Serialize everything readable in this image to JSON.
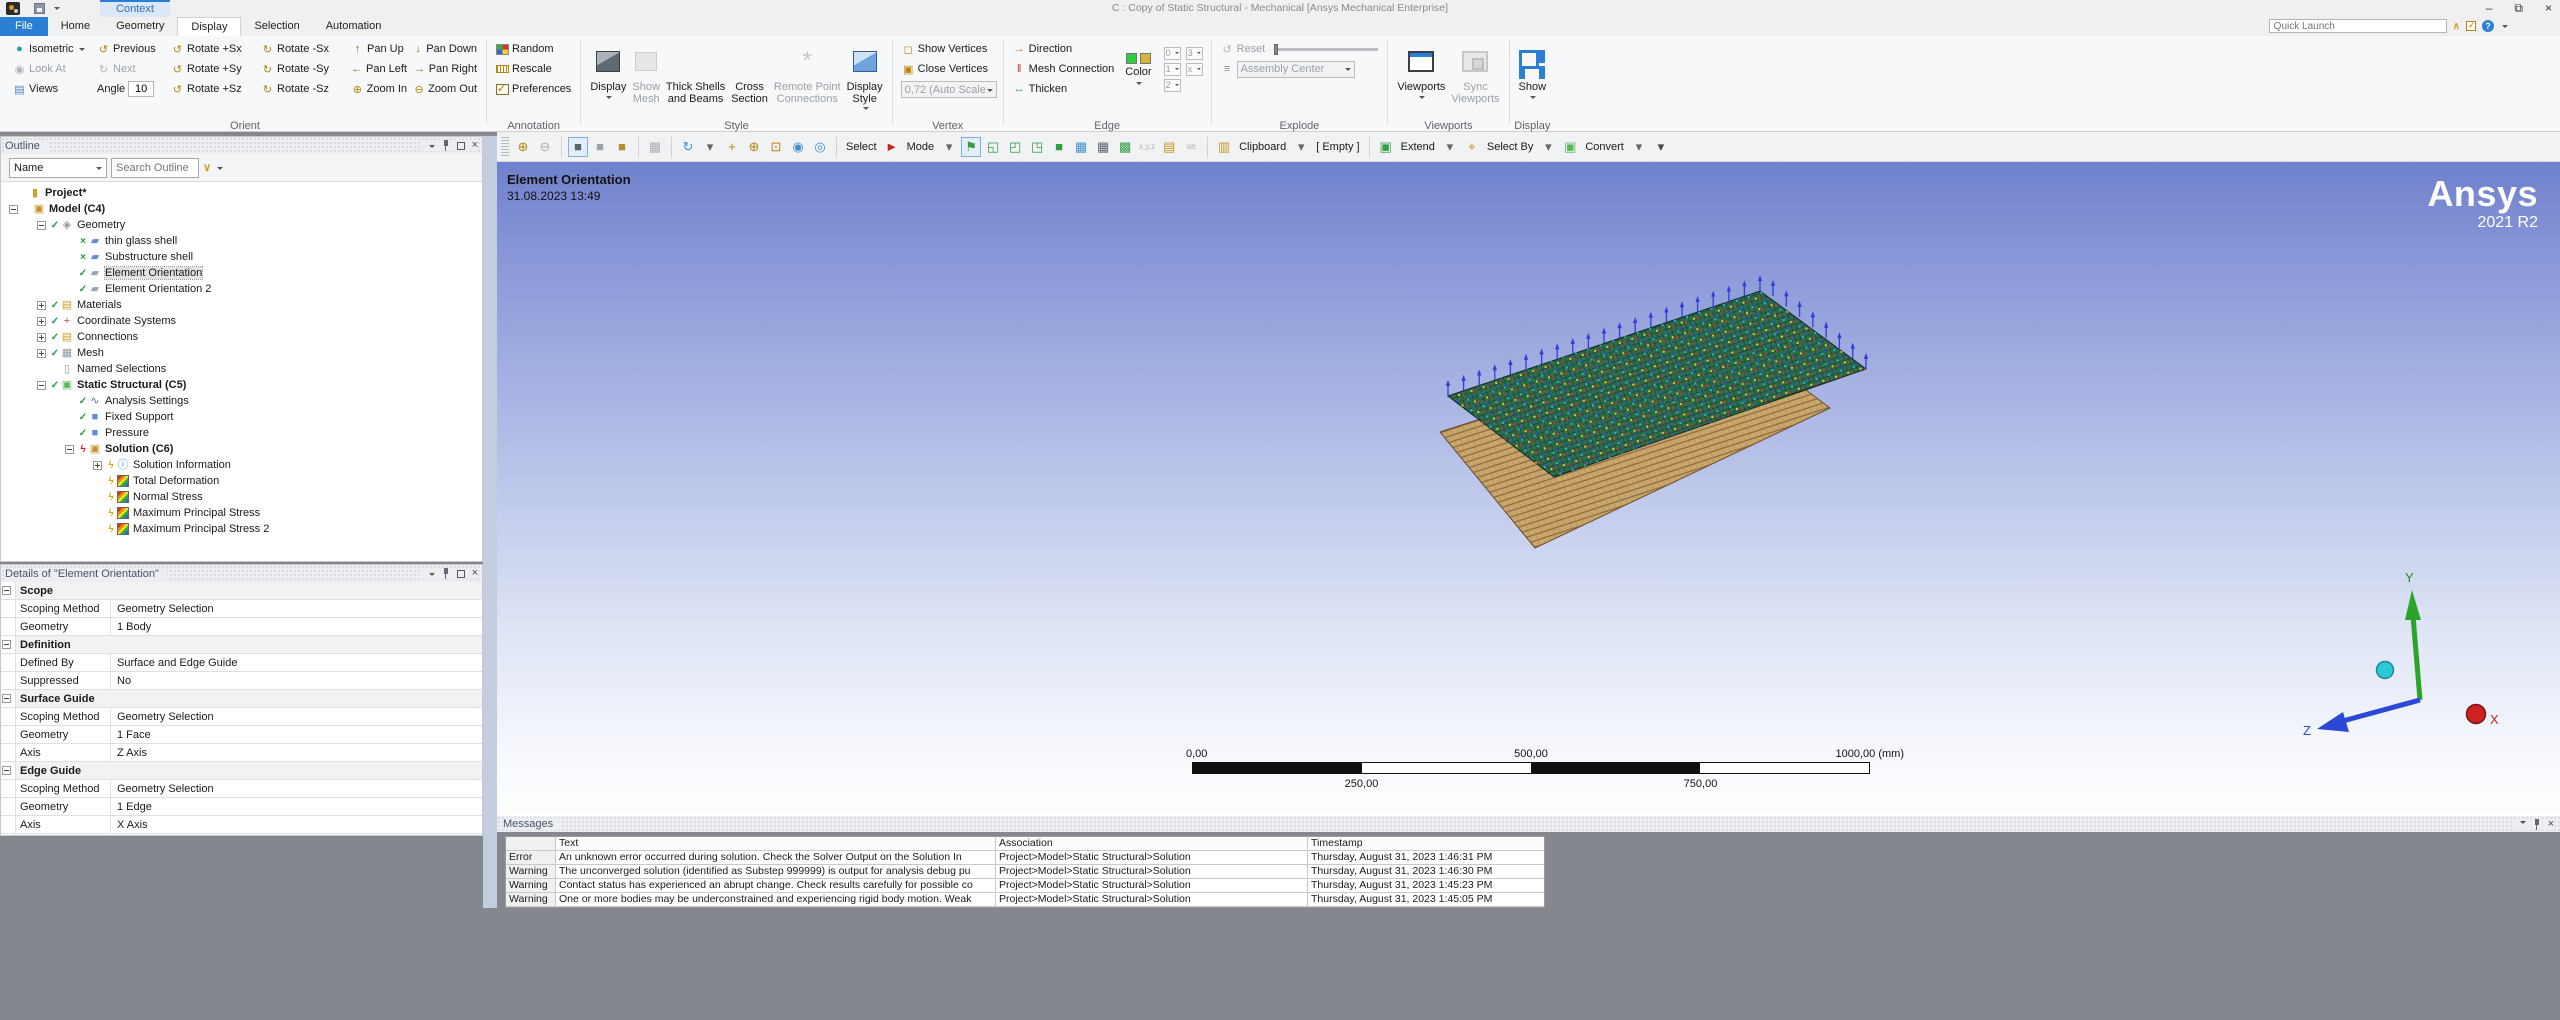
{
  "window": {
    "title": "C : Copy of Static Structural - Mechanical [Ansys Mechanical Enterprise]",
    "context_label": "Context",
    "controls": {
      "minimize": "–",
      "restore": "⧉",
      "close": "×"
    }
  },
  "quick_launch": {
    "placeholder": "Quick Launch"
  },
  "tabs": [
    {
      "label": "File",
      "style": "file"
    },
    {
      "label": "Home"
    },
    {
      "label": "Geometry"
    },
    {
      "label": "Display",
      "active": true
    },
    {
      "label": "Selection"
    },
    {
      "label": "Automation"
    }
  ],
  "ribbon": {
    "groups": [
      {
        "key": "orient",
        "label": "Orient",
        "type": "grid",
        "cells": [
          {
            "icon": "isometric-icon",
            "glyph": "●",
            "color": "#18a3a8",
            "label": "Isometric",
            "caret": true
          },
          {
            "icon": "previous-icon",
            "glyph": "↺",
            "color": "#b8860b",
            "label": "Previous"
          },
          {
            "icon": "rotate-plus-icon",
            "glyph": "↺",
            "color": "#b8860b",
            "label": "Rotate +Sx"
          },
          {
            "icon": "rotate-minus-icon",
            "glyph": "↻",
            "color": "#b8860b",
            "label": "Rotate -Sx"
          },
          {
            "icon": "pan-up-icon",
            "glyph": "↑",
            "color": "#8a6d1f",
            "label": "Pan Up"
          },
          {
            "icon": "pan-down-icon",
            "glyph": "↓",
            "color": "#8a6d1f",
            "label": "Pan Down"
          },
          {
            "icon": "look-at-icon",
            "glyph": "◉",
            "color": "#9aa0a6",
            "label": "Look At",
            "disabled": true
          },
          {
            "icon": "next-icon",
            "glyph": "↻",
            "color": "#9aa0a6",
            "label": "Next",
            "disabled": true
          },
          {
            "icon": "rotate-plus-icon",
            "glyph": "↺",
            "color": "#b8860b",
            "label": "Rotate +Sy"
          },
          {
            "icon": "rotate-minus-icon",
            "glyph": "↻",
            "color": "#b8860b",
            "label": "Rotate -Sy"
          },
          {
            "icon": "pan-left-icon",
            "glyph": "←",
            "color": "#8a6d1f",
            "label": "Pan Left"
          },
          {
            "icon": "pan-right-icon",
            "glyph": "→",
            "color": "#8a6d1f",
            "label": "Pan Right"
          },
          {
            "icon": "views-icon",
            "glyph": "▤",
            "color": "#4a7fc1",
            "label": "Views"
          },
          {
            "angle_label": "Angle",
            "angle_value": "10"
          },
          {
            "icon": "rotate-plus-icon",
            "glyph": "↺",
            "color": "#b8860b",
            "label": "Rotate +Sz"
          },
          {
            "icon": "rotate-minus-icon",
            "glyph": "↻",
            "color": "#b8860b",
            "label": "Rotate -Sz"
          },
          {
            "icon": "zoom-in-icon",
            "glyph": "⊕",
            "color": "#b8860b",
            "label": "Zoom In"
          },
          {
            "icon": "zoom-out-icon",
            "glyph": "⊖",
            "color": "#b8860b",
            "label": "Zoom Out"
          }
        ]
      },
      {
        "key": "annotation",
        "label": "Annotation",
        "type": "stack",
        "buttons": [
          {
            "icon": "random-colors",
            "label": "Random"
          },
          {
            "icon": "rescale",
            "label": "Rescale"
          },
          {
            "icon": "preferences",
            "label": "Preferences"
          }
        ]
      },
      {
        "key": "style",
        "label": "Style",
        "type": "big",
        "buttons": [
          {
            "icon": "cube-dark",
            "label": "Display",
            "caret": true
          },
          {
            "icon": "cube-gray",
            "label": "Show\nMesh",
            "disabled": true
          },
          {
            "icon": "ibeam-dark",
            "label": "Thick Shells\nand Beams"
          },
          {
            "icon": "ibeam-gold",
            "label": "Cross\nSection"
          },
          {
            "icon": "starburst",
            "glyph": "*",
            "label": "Remote Point\nConnections",
            "disabled": true
          },
          {
            "icon": "cube-blue",
            "label": "Display\nStyle",
            "caret": true
          }
        ]
      },
      {
        "key": "vertex",
        "label": "Vertex",
        "type": "stack",
        "buttons": [
          {
            "icon": "show-vertices-icon",
            "glyph": "◻",
            "color": "#b8860b",
            "label": "Show Vertices"
          },
          {
            "icon": "close-vertices-icon",
            "glyph": "▣",
            "color": "#b8860b",
            "label": "Close Vertices"
          },
          {
            "combo": "0,72 (Auto Scale",
            "disabled": true
          }
        ]
      },
      {
        "key": "edge",
        "label": "Edge",
        "type": "edge",
        "buttons": [
          {
            "icon": "direction-icon",
            "glyph": "→",
            "color": "#d07818",
            "label": "Direction"
          },
          {
            "icon": "mesh-connection-icon",
            "glyph": "‖",
            "color": "#c23030",
            "label": "Mesh Connection"
          },
          {
            "icon": "thicken-icon",
            "glyph": "↔",
            "color": "#2f9e44",
            "label": "Thicken"
          }
        ],
        "color_label": "Color",
        "swatches": [
          "#2ecc40",
          "#d9b43a"
        ],
        "minis": [
          "0",
          "3",
          "1",
          "x",
          "2"
        ]
      },
      {
        "key": "explode",
        "label": "Explode",
        "type": "explode",
        "reset_label": "Reset",
        "combo": "Assembly Center"
      },
      {
        "key": "viewports",
        "label": "Viewports",
        "type": "big",
        "buttons": [
          {
            "icon": "viewport-window",
            "label": "Viewports",
            "caret": true
          },
          {
            "icon": "viewport-lock",
            "label": "Sync\nViewports",
            "disabled": true
          }
        ]
      },
      {
        "key": "display",
        "label": "Display",
        "type": "big",
        "buttons": [
          {
            "icon": "show-layout",
            "label": "Show",
            "caret": true
          }
        ]
      }
    ]
  },
  "gtoolbar": {
    "items": [
      {
        "n": "toolbar-grip",
        "t": "grip"
      },
      {
        "n": "zoom-in-icon",
        "g": "⊕",
        "c": "#b8860b"
      },
      {
        "n": "zoom-out-icon",
        "g": "⊖",
        "c": "#a9adb2"
      },
      {
        "t": "sep"
      },
      {
        "n": "shaded-exterior-edges-icon",
        "g": "■",
        "c": "#5a6572",
        "boxed": true
      },
      {
        "n": "shaded-exterior-icon",
        "g": "■",
        "c": "#9aa3ad"
      },
      {
        "n": "wireframe-icon",
        "g": "■",
        "c": "#b98c2f"
      },
      {
        "t": "sep"
      },
      {
        "n": "multi-viewport-icon",
        "g": "▦",
        "c": "#a9adb2"
      },
      {
        "t": "sep"
      },
      {
        "n": "rotate-mode-icon",
        "g": "↻",
        "c": "#3f8fd2"
      },
      {
        "n": "rotate-mode-caret",
        "g": "▾",
        "c": "#666"
      },
      {
        "n": "pan-mode-icon",
        "g": "+",
        "c": "#b8860b"
      },
      {
        "n": "zoom-mode-icon",
        "g": "⊕",
        "c": "#b8860b"
      },
      {
        "n": "box-zoom-icon",
        "g": "⊡",
        "c": "#b8860b"
      },
      {
        "n": "zoom-fit-icon",
        "g": "◉",
        "c": "#3f8fd2"
      },
      {
        "n": "zoom-all-icon",
        "g": "◎",
        "c": "#3f8fd2"
      },
      {
        "t": "sep"
      },
      {
        "t": "text",
        "n": "select-label",
        "label": "Select"
      },
      {
        "n": "select-cursor-icon",
        "g": "►",
        "c": "#cc2222"
      },
      {
        "t": "text",
        "n": "mode-label",
        "label": "Mode"
      },
      {
        "n": "mode-caret",
        "g": "▾",
        "c": "#666"
      },
      {
        "n": "select-vertex-icon",
        "g": "⚑",
        "c": "#2f9e44",
        "boxed": true
      },
      {
        "n": "select-edge-icon",
        "g": "◱",
        "c": "#2f9e44"
      },
      {
        "n": "select-face-icon",
        "g": "◰",
        "c": "#2f9e44"
      },
      {
        "n": "select-body-icon",
        "g": "◳",
        "c": "#2f9e44"
      },
      {
        "n": "select-body-solid-icon",
        "g": "■",
        "c": "#2f9e44"
      },
      {
        "n": "select-mesh-icon",
        "g": "▦",
        "c": "#3f8fd2"
      },
      {
        "n": "mesh-element-select-icon",
        "g": "▦",
        "c": "#5a6572"
      },
      {
        "n": "mesh-node-select-icon",
        "g": "▩",
        "c": "#2f9e44"
      },
      {
        "n": "coordinates-icon",
        "g": "x,y,z",
        "c": "#b0b4b9",
        "small": true
      },
      {
        "n": "tag-icon",
        "g": "▤",
        "c": "#c9971c"
      },
      {
        "n": "annotation-label-icon",
        "g": "ab",
        "c": "#b0b4b9",
        "small": true
      },
      {
        "t": "sep"
      },
      {
        "n": "clipboard-icon",
        "g": "▥",
        "c": "#c9971c"
      },
      {
        "t": "text",
        "n": "clipboard-label",
        "label": "Clipboard"
      },
      {
        "n": "clipboard-caret",
        "g": "▾",
        "c": "#666"
      },
      {
        "t": "text",
        "n": "clipboard-empty-label",
        "label": "[ Empty ]"
      },
      {
        "t": "sep"
      },
      {
        "n": "extend-icon",
        "g": "▣",
        "c": "#2f9e44"
      },
      {
        "t": "text",
        "n": "extend-label",
        "label": "Extend"
      },
      {
        "n": "extend-caret",
        "g": "▾",
        "c": "#666"
      },
      {
        "n": "select-by-icon",
        "g": "⌖",
        "c": "#c9971c"
      },
      {
        "t": "text",
        "n": "select-by-label",
        "label": "Select By"
      },
      {
        "n": "select-by-caret",
        "g": "▾",
        "c": "#666"
      },
      {
        "n": "convert-icon",
        "g": "▣",
        "c": "#57b857"
      },
      {
        "t": "text",
        "n": "convert-label",
        "label": "Convert"
      },
      {
        "n": "convert-caret",
        "g": "▾",
        "c": "#666"
      },
      {
        "n": "toolbar-overflow-caret",
        "g": "▾",
        "c": "#444"
      }
    ]
  },
  "outline": {
    "title": "Outline",
    "filter_label": "Name",
    "search_placeholder": "Search Outline",
    "markers": {
      "check": "✓",
      "xgreen": "×",
      "boltred": "ϟ",
      "boltyellow": "ϟ"
    },
    "tree": [
      {
        "label": "Project*",
        "lvl": 0,
        "icon": "project",
        "glyph": "▮",
        "color": "#c9a227",
        "bold": true
      },
      {
        "label": "Model (C4)",
        "lvl": 1,
        "icon": "model",
        "glyph": "▣",
        "color": "#c98f2c",
        "exp": "minus",
        "bold": true
      },
      {
        "label": "Geometry",
        "lvl": 2,
        "icon": "geometry",
        "glyph": "◈",
        "color": "#8a98a8",
        "exp": "minus",
        "marker": "check"
      },
      {
        "label": "thin glass shell",
        "lvl": 3,
        "icon": "surface-body",
        "glyph": "▰",
        "color": "#5b8dd9",
        "marker": "xgreen"
      },
      {
        "label": "Substructure shell",
        "lvl": 3,
        "icon": "surface-body",
        "glyph": "▰",
        "color": "#5b8dd9",
        "marker": "xgreen"
      },
      {
        "label": "Element Orientation",
        "lvl": 3,
        "icon": "element-orientation",
        "glyph": "▰",
        "color": "#9aa4b0",
        "marker": "check",
        "selected": true
      },
      {
        "label": "Element Orientation 2",
        "lvl": 3,
        "icon": "element-orientation",
        "glyph": "▰",
        "color": "#9aa4b0",
        "marker": "check"
      },
      {
        "label": "Materials",
        "lvl": 2,
        "icon": "materials",
        "glyph": "▤",
        "color": "#c9a227",
        "exp": "plus",
        "marker": "check"
      },
      {
        "label": "Coordinate Systems",
        "lvl": 2,
        "icon": "coordinate-systems",
        "glyph": "+",
        "color": "#cc4444",
        "exp": "plus",
        "marker": "check"
      },
      {
        "label": "Connections",
        "lvl": 2,
        "icon": "connections",
        "glyph": "▤",
        "color": "#c9a227",
        "exp": "plus",
        "marker": "check"
      },
      {
        "label": "Mesh",
        "lvl": 2,
        "icon": "mesh",
        "glyph": "▦",
        "color": "#8a98a8",
        "exp": "plus",
        "marker": "check"
      },
      {
        "label": "Named Selections",
        "lvl": 2,
        "icon": "named-selections",
        "glyph": "▯",
        "color": "#8a98a8"
      },
      {
        "label": "Static Structural (C5)",
        "lvl": 2,
        "icon": "static-structural",
        "glyph": "▣",
        "color": "#57b857",
        "exp": "minus",
        "marker": "check",
        "bold": true
      },
      {
        "label": "Analysis Settings",
        "lvl": 3,
        "icon": "analysis-settings",
        "glyph": "∿",
        "color": "#667788",
        "marker": "check"
      },
      {
        "label": "Fixed Support",
        "lvl": 3,
        "icon": "fixed-support",
        "glyph": "■",
        "color": "#5b8dd9",
        "marker": "check"
      },
      {
        "label": "Pressure",
        "lvl": 3,
        "icon": "pressure",
        "glyph": "■",
        "color": "#5b8dd9",
        "marker": "check"
      },
      {
        "label": "Solution (C6)",
        "lvl": 3,
        "icon": "solution",
        "glyph": "▣",
        "color": "#c98f2c",
        "exp": "minus",
        "marker": "boltred",
        "bold": true
      },
      {
        "label": "Solution Information",
        "lvl": 4,
        "icon": "solution-information",
        "glyph": "ⓘ",
        "color": "#3f8fd2",
        "exp": "plus",
        "marker": "boltyellow"
      },
      {
        "label": "Total Deformation",
        "lvl": 4,
        "icon": "result-contour",
        "glyph": "",
        "color": "",
        "marker": "boltyellow"
      },
      {
        "label": "Normal Stress",
        "lvl": 4,
        "icon": "result-contour",
        "glyph": "",
        "color": "",
        "marker": "boltyellow"
      },
      {
        "label": "Maximum Principal Stress",
        "lvl": 4,
        "icon": "result-contour",
        "glyph": "",
        "color": "",
        "marker": "boltyellow"
      },
      {
        "label": "Maximum Principal Stress 2",
        "lvl": 4,
        "icon": "result-contour",
        "glyph": "",
        "color": "",
        "marker": "boltyellow"
      }
    ]
  },
  "details": {
    "title": "Details of \"Element Orientation\"",
    "sections": [
      {
        "name": "Scope",
        "rows": [
          [
            "Scoping Method",
            "Geometry Selection"
          ],
          [
            "Geometry",
            "1 Body"
          ]
        ]
      },
      {
        "name": "Definition",
        "rows": [
          [
            "Defined By",
            "Surface and Edge Guide"
          ],
          [
            "Suppressed",
            "No"
          ]
        ]
      },
      {
        "name": "Surface Guide",
        "rows": [
          [
            "Scoping Method",
            "Geometry Selection"
          ],
          [
            "Geometry",
            "1 Face"
          ],
          [
            "Axis",
            "Z Axis"
          ]
        ]
      },
      {
        "name": "Edge Guide",
        "rows": [
          [
            "Scoping Method",
            "Geometry Selection"
          ],
          [
            "Geometry",
            "1 Edge"
          ],
          [
            "Axis",
            "X Axis"
          ]
        ]
      }
    ]
  },
  "viewport": {
    "annotation_title": "Element Orientation",
    "annotation_date": "31.08.2023 13:49",
    "brand": "Ansys",
    "brand_sub": "2021 R2",
    "ruler": {
      "top_labels": [
        "0,00",
        "500,00",
        "1000,00 (mm)"
      ],
      "bottom_labels": [
        "250,00",
        "750,00"
      ]
    },
    "triad": {
      "x": "X",
      "y": "Y",
      "z": "Z"
    },
    "colors": {
      "accent_blue": "#2a7fd4",
      "mesh_green": "#2f6d4e",
      "mesh_tan": "#c8a66c",
      "arrow_blue": "#2f3fd4"
    }
  },
  "messages": {
    "title": "Messages",
    "columns": [
      "",
      "Text",
      "Association",
      "Timestamp"
    ],
    "rows": [
      {
        "severity": "Error",
        "text": "An unknown error occurred during solution.  Check the Solver Output on the Solution In",
        "association": "Project>Model>Static Structural>Solution",
        "timestamp": "Thursday, August 31, 2023 1:46:31 PM"
      },
      {
        "severity": "Warning",
        "text": "The unconverged solution (identified as Substep 999999) is output for analysis debug pu",
        "association": "Project>Model>Static Structural>Solution",
        "timestamp": "Thursday, August 31, 2023 1:46:30 PM"
      },
      {
        "severity": "Warning",
        "text": "Contact status has experienced an abrupt change.  Check results carefully for possible co",
        "association": "Project>Model>Static Structural>Solution",
        "timestamp": "Thursday, August 31, 2023 1:45:23 PM"
      },
      {
        "severity": "Warning",
        "text": "One or more bodies may be underconstrained and experiencing rigid body motion. Weak",
        "association": "Project>Model>Static Structural>Solution",
        "timestamp": "Thursday, August 31, 2023 1:45:05 PM"
      }
    ]
  }
}
